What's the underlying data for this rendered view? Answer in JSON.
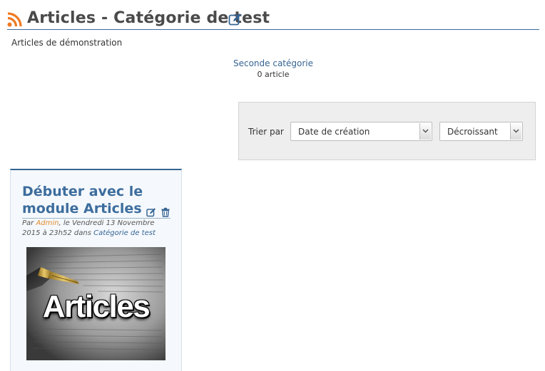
{
  "header": {
    "title": "Articles - Catégorie de test",
    "rss_icon": "rss-icon",
    "edit_icon": "edit-icon"
  },
  "category": {
    "description": "Articles de démonstration"
  },
  "subcategories": [
    {
      "name": "Seconde catégorie",
      "count": "0 article"
    }
  ],
  "sort": {
    "label": "Trier par",
    "field": {
      "selected": "Date de création"
    },
    "order": {
      "selected": "Décroissant"
    }
  },
  "articles": [
    {
      "title": "Débuter avec le module Articles",
      "meta_prefix": "Par ",
      "author": "Admin",
      "meta_date": ", le Vendredi 13 Novembre 2015 à 23h52 dans ",
      "category": "Catégorie de test",
      "thumbnail_text": "Articles",
      "edit_icon": "edit-icon",
      "delete_icon": "trash-icon"
    }
  ],
  "colors": {
    "accent": "#366493",
    "author": "#e38b2e",
    "rss": "#f07a22",
    "sort_bg": "#eeeeee",
    "card_bg": "#f5f9fd"
  }
}
